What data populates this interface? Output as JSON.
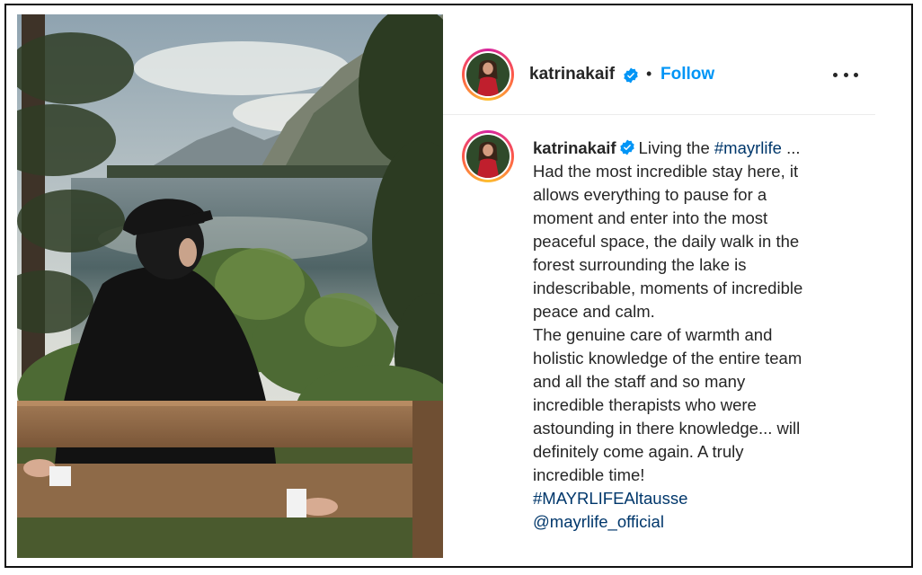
{
  "post": {
    "username": "katrinakaif",
    "follow_label": "Follow",
    "dot": "•",
    "more_icon": "more-horizontal-icon",
    "verified_icon": "verified-badge-icon",
    "accent_color": "#0095f6",
    "link_color": "#00376b"
  },
  "caption": {
    "username": "katrinakaif",
    "intro": "Living the",
    "hashtag_mayrlife": "#mayrlife",
    "ellipsis": " ...",
    "lines": [
      "Had the most incredible stay here, it",
      "allows everything to pause for a",
      "moment and enter into the most",
      "peaceful space, the daily walk in the",
      "forest surrounding the lake is",
      "indescribable, moments of incredible",
      "peace and calm.",
      "The genuine care of warmth and",
      "holistic knowledge of the entire team",
      "and all the staff and so many",
      "incredible therapists who were",
      "astounding in there knowledge... will",
      "definitely come again. A truly",
      "incredible time!"
    ],
    "hashtag": "#MAYRLIFEAltausse",
    "mention": "@mayrlife_official"
  }
}
